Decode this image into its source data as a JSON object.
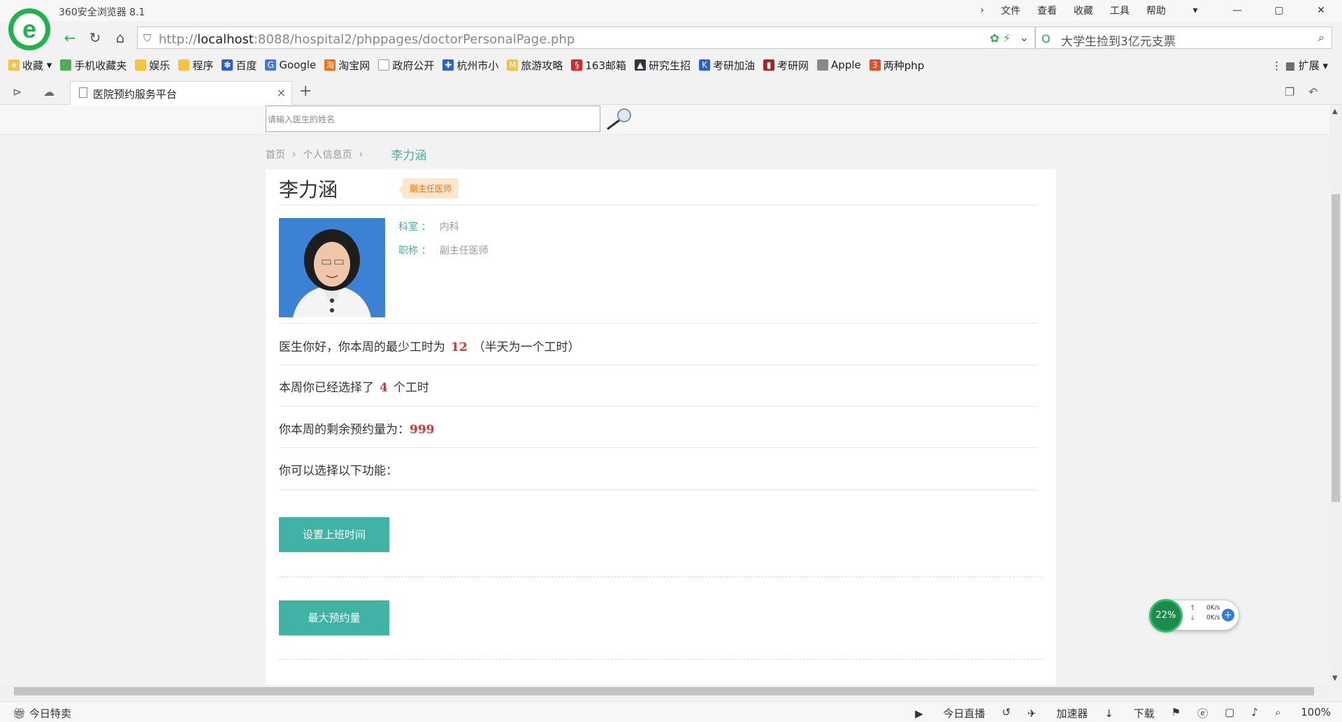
{
  "browser": {
    "app_title": "360安全浏览器 8.1",
    "menu": [
      "文件",
      "查看",
      "收藏",
      "工具",
      "帮助"
    ],
    "url_prefix": "http://",
    "url_host": "localhost",
    "url_rest": ":8088/hospital2/phppages/doctorPersonalPage.php",
    "search_text": "大学生捡到3亿元支票",
    "bookmarks": [
      "收藏",
      "手机收藏夹",
      "娱乐",
      "程序",
      "百度",
      "Google",
      "淘宝网",
      "政府公开",
      "杭州市小",
      "旅游攻略",
      "163邮箱",
      "研究生招",
      "考研加油",
      "考研网",
      "Apple",
      "两种php"
    ],
    "extensions_label": "扩展",
    "tab_title": "医院预约服务平台",
    "status_left": "今日特卖",
    "status_right": [
      "今日直播",
      "加速器",
      "下载",
      "100%"
    ],
    "accent": "#21b24b"
  },
  "page": {
    "search_placeholder": "请输入医生的姓名",
    "breadcrumb": [
      "首页",
      "个人信息页"
    ],
    "breadcrumb_current": "李力涵",
    "doctor_name": "李力涵",
    "title_badge": "副主任医师",
    "dept_label": "科室 ：",
    "dept_value": "内科",
    "title_label": "职称 ：",
    "title_value": "副主任医师",
    "min_hours_prefix": "医生你好，你本周的最少工时为",
    "min_hours": "12",
    "min_hours_suffix": "（半天为一个工时）",
    "selected_prefix": "本周你已经选择了",
    "selected_hours": "4",
    "selected_suffix": "个工时",
    "remaining_prefix": "你本周的剩余预约量为：",
    "remaining": "999",
    "functions_label": "你可以选择以下功能：",
    "btn_set_schedule": "设置上班时间",
    "btn_max_booking": "最大预约量",
    "accent": "#40b3a4",
    "highlight": "#e03030"
  },
  "net_widget": {
    "cpu": "22%",
    "up": "0K/s",
    "down": "0K/s"
  }
}
